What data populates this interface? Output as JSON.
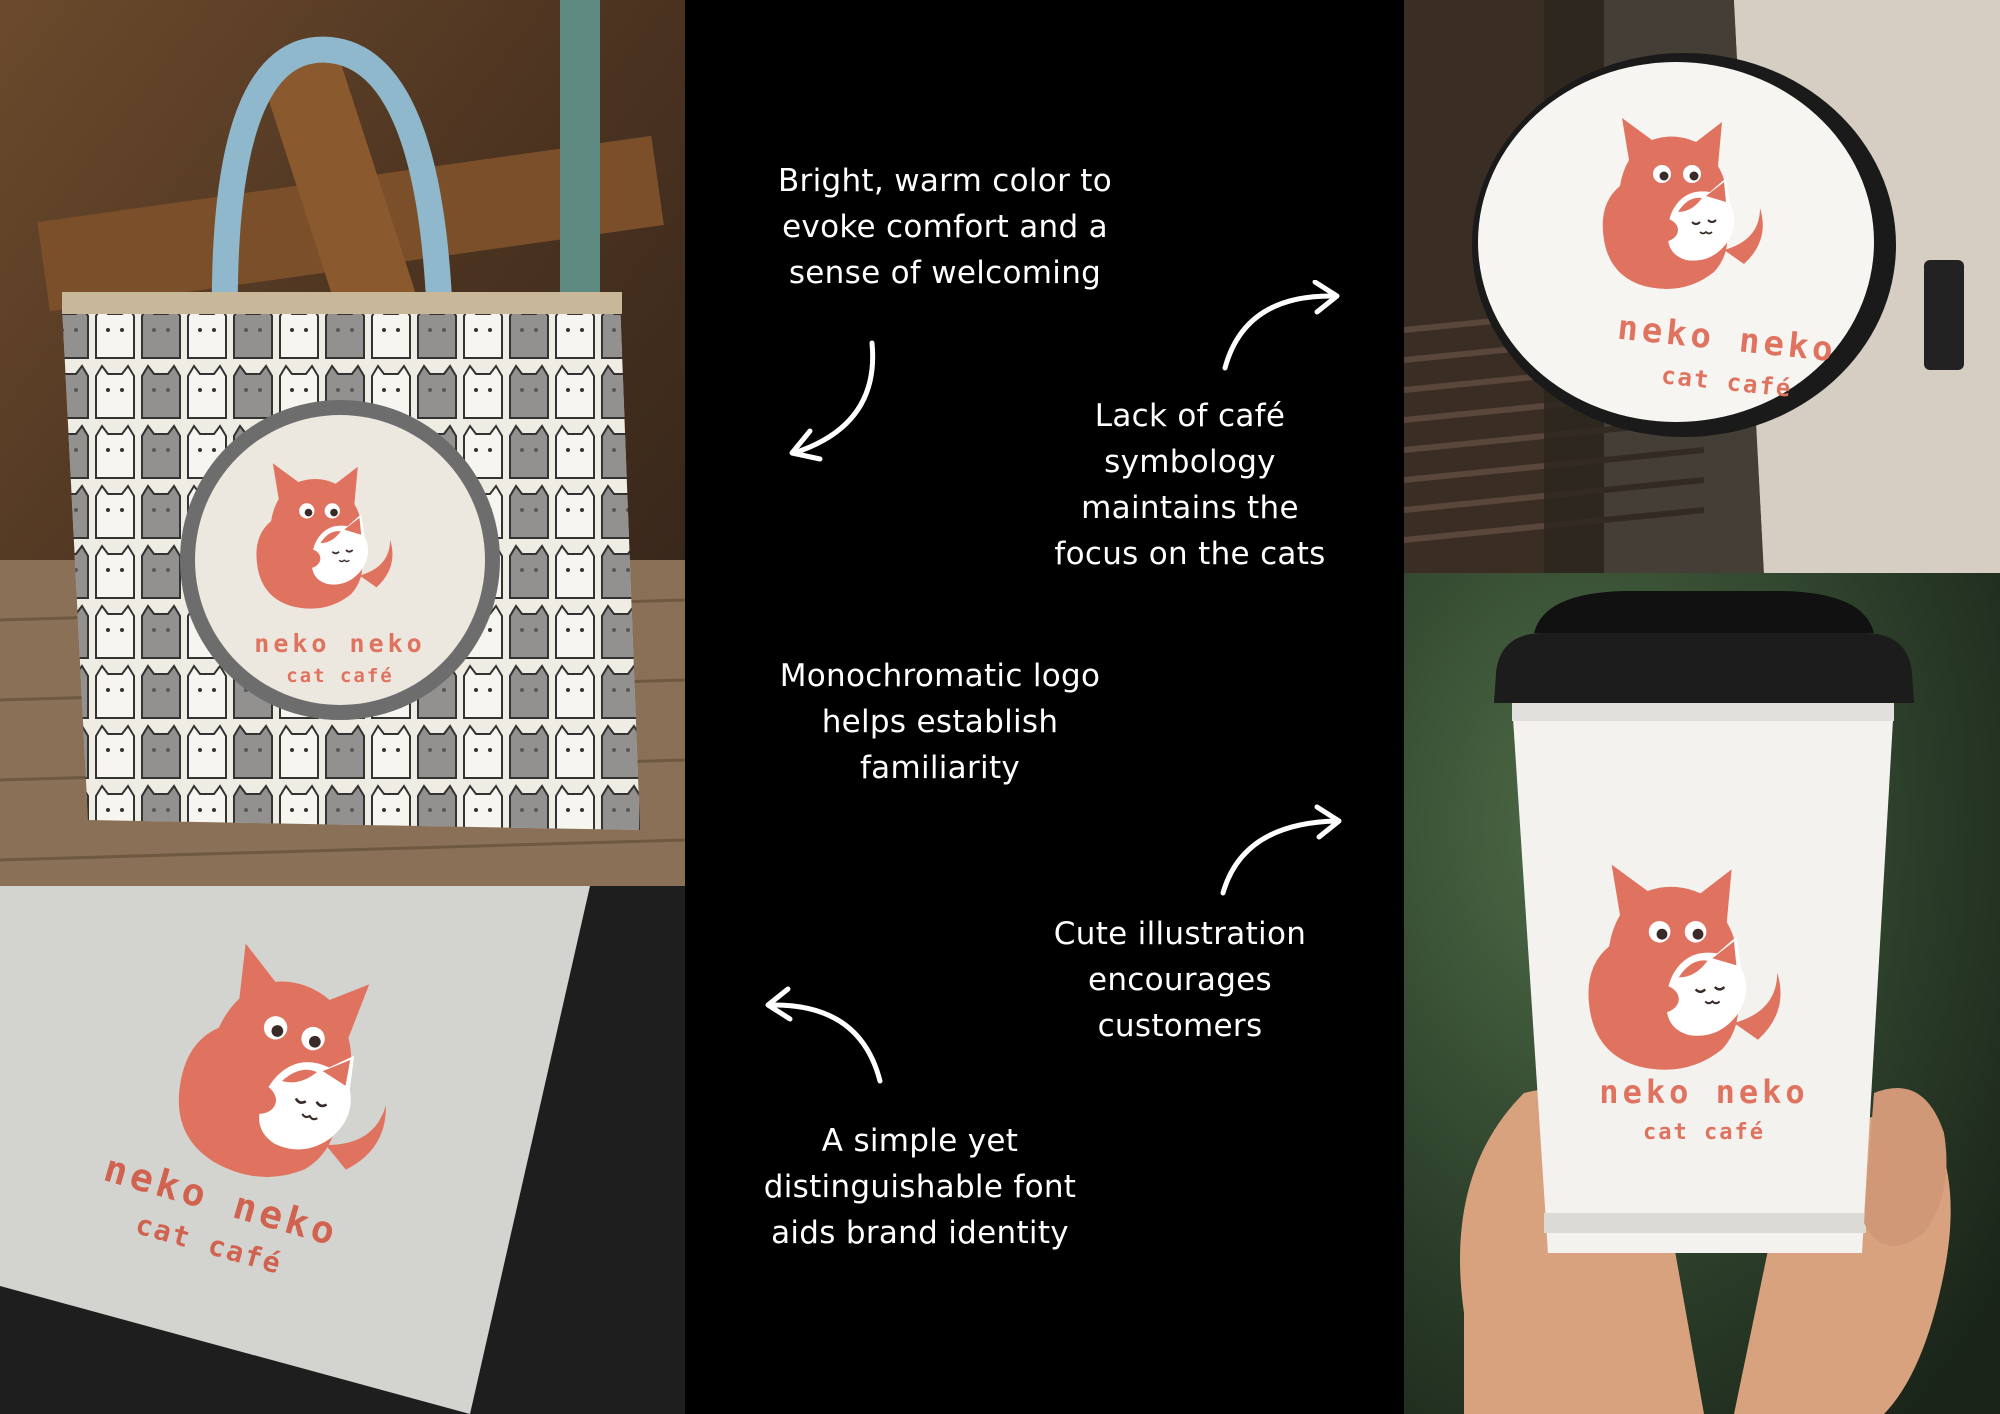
{
  "brand": {
    "name": "neko neko",
    "tagline": "cat café",
    "color": "#E0735F"
  },
  "notes": {
    "n1": [
      "Bright, warm color to",
      "evoke comfort and a",
      "sense of welcoming"
    ],
    "n2": [
      "Lack of café",
      "symbology",
      "maintains the",
      "focus on the cats"
    ],
    "n3": [
      "Monochromatic logo",
      "helps establish",
      "familiarity"
    ],
    "n4": [
      "Cute illustration",
      "encourages",
      "customers"
    ],
    "n5": [
      "A simple yet",
      "distinguishable font",
      "aids brand identity"
    ]
  },
  "icons": {
    "logo": "cat-logo-icon",
    "arrows": [
      "curved-arrow-icon"
    ]
  },
  "colors": {
    "background": "#000000",
    "text": "#FFFFFF",
    "accent": "#E0735F"
  }
}
